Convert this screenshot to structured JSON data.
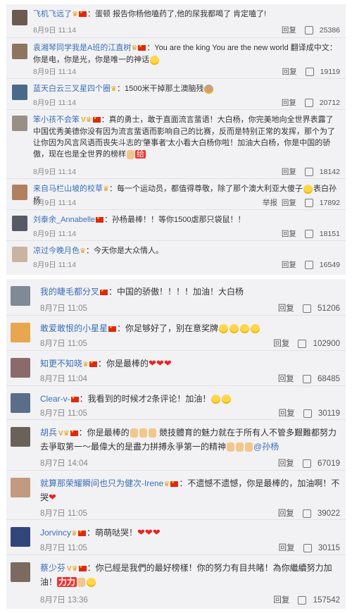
{
  "panel1": {
    "comments": [
      {
        "user": "飞机飞远了",
        "text": "：蛋顿 报告你杨他嗑药了,他的尿我都喝了 肯定嗑了!",
        "date": "8月9日 11:14",
        "actions": [
          "回复"
        ],
        "likes": "25386"
      },
      {
        "user": "袁湘琴同学我是A班的江直树",
        "text": "：You are the king You are the new world 翻译成中文：你是电，你是光，你是唯一的神话",
        "date": "8月9日 11:14",
        "actions": [
          "回复"
        ],
        "likes": "19119"
      },
      {
        "user": "蓝天白云三叉星四个圈",
        "text": "：1500米干掉那土澳脑残",
        "date": "8月9日 11:14",
        "actions": [
          "回复"
        ],
        "likes": "20712"
      },
      {
        "user": "笨小孩不会笨",
        "text": "：真的勇士，敢于直面流言蜚语！大白杨，你完美地向全世界表露了中国优秀美德你没有因为流言蜚语而影响自己的比赛，反而是特别正常的发挥，那个为了让你因为风言风语而丧失斗志的'肇事者'太小看大白杨你啦！加油大白杨，你是中国的骄傲，现在也是全世界的榜样",
        "date": "8月9日 11:14",
        "actions": [
          "回复"
        ],
        "likes": "18142",
        "extra": "给"
      },
      {
        "user": "来自马栏山坡的校草",
        "text": "：每一个运动员，都值得尊敬，除了那个澳大利亚大傻子",
        "text2": "表白孙杨",
        "date": "8月9日 11:14",
        "actions": [
          "举报",
          "回复"
        ],
        "likes": "17892"
      },
      {
        "user": "刘泰余_Annabelle",
        "text": "：孙杨最棒！！等你1500虐那只袋鼠！！",
        "date": "8月9日 11:14",
        "actions": [
          "回复"
        ],
        "likes": "18151"
      },
      {
        "user": "凉过今晚月色",
        "text": "：今天你是大众情人。",
        "date": "8月9日 11:14",
        "actions": [
          "回复"
        ],
        "likes": "16549"
      }
    ]
  },
  "panel2": {
    "comments": [
      {
        "user": "我的睫毛都分叉",
        "text": "：中国的骄傲！！！！加油！大白杨",
        "date": "8月7日 11:05",
        "actions": [
          "回复"
        ],
        "likes": "51206"
      },
      {
        "user": "敢爱敢恨的小星星",
        "text": "：你足够好了，别在意奖牌",
        "date": "8月7日 11:05",
        "actions": [
          "回复"
        ],
        "likes": "102900"
      },
      {
        "user": "知更不知晓",
        "text": "：你是最棒的",
        "date": "8月7日 11:04",
        "actions": [
          "回复"
        ],
        "likes": "68485"
      },
      {
        "user": "Clear-v-",
        "text": "：我看到的时候才2条评论！加油！",
        "date": "8月7日 11:05",
        "actions": [
          "回复"
        ],
        "likes": "30119"
      },
      {
        "user": "胡兵",
        "text": "：你是最棒的",
        "text2": "競技體育的魅力就在于所有人不管多艱難都努力去爭取第一～最偉大的是盡力拼搏永爭第一的精神",
        "mention": "@孙杨",
        "date": "8月7日 14:04",
        "actions": [
          "回复"
        ],
        "likes": "67019"
      },
      {
        "user": "就算那荣耀瞬间也只为健次-Irene",
        "text": "：不遗憾不遗憾，你是最棒的，加油啊！不哭",
        "date": "8月7日 11:05",
        "actions": [
          "回复"
        ],
        "likes": "39022"
      },
      {
        "user": "Jorvincy",
        "text": "：萌萌哒哭！",
        "date": "8月7日 11:05",
        "actions": [
          "回复"
        ],
        "likes": "30115"
      },
      {
        "user": "蔡少芬",
        "text": "：你已經是我們的最好榜樣！你的努力有目共睹！為你繼續努力加油！",
        "extra": "力力",
        "date": "8月7日 13:36",
        "actions": [
          "回复"
        ],
        "likes": "157542"
      }
    ]
  },
  "colors": {
    "username": "#3b6eb5",
    "background": "#f2f2f5",
    "heart": "#e8231f",
    "flag": "#de2910"
  },
  "icons": [
    "vip-crown-icon",
    "china-flag-icon",
    "emoji-icon",
    "heart-icon",
    "thumbs-up-icon",
    "like-icon"
  ]
}
